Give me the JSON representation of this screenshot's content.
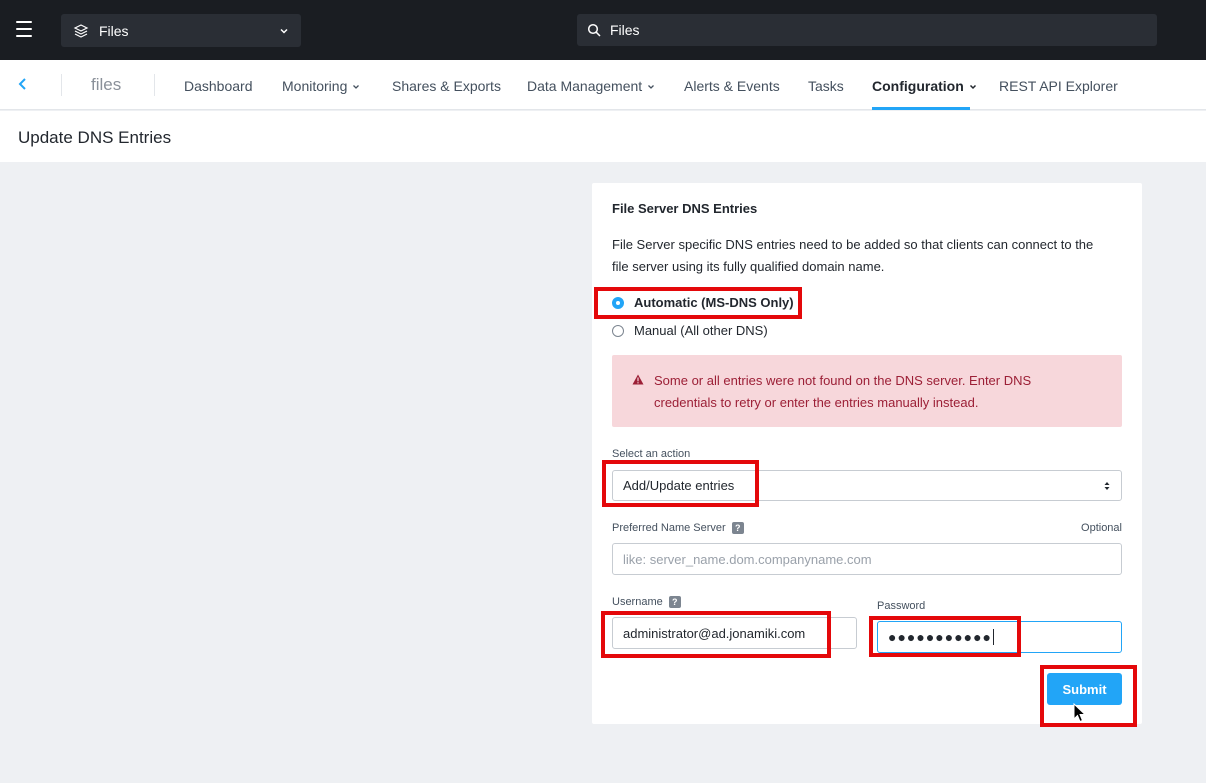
{
  "topbar": {
    "app_selector_label": "Files",
    "search_value": "Files"
  },
  "nav": {
    "brand": "files",
    "tabs": [
      {
        "label": "Dashboard",
        "dropdown": false
      },
      {
        "label": "Monitoring",
        "dropdown": true
      },
      {
        "label": "Shares & Exports",
        "dropdown": false
      },
      {
        "label": "Data Management",
        "dropdown": true
      },
      {
        "label": "Alerts & Events",
        "dropdown": false
      },
      {
        "label": "Tasks",
        "dropdown": false
      },
      {
        "label": "Configuration",
        "dropdown": true,
        "active": true
      },
      {
        "label": "REST API Explorer",
        "dropdown": false
      }
    ]
  },
  "page": {
    "title": "Update DNS Entries"
  },
  "form": {
    "section_title": "File Server DNS Entries",
    "description": "File Server specific DNS entries need to be added so that clients can connect to the file server using its fully qualified domain name.",
    "radios": [
      {
        "label": "Automatic (MS-DNS Only)",
        "checked": true
      },
      {
        "label": "Manual (All other DNS)",
        "checked": false
      }
    ],
    "alert_text": "Some or all entries were not found on the DNS server. Enter DNS credentials to retry or enter the entries manually instead.",
    "action_label": "Select an action",
    "action_value": "Add/Update entries",
    "name_server_label": "Preferred Name Server",
    "name_server_optional": "Optional",
    "name_server_placeholder": "like: server_name.dom.companyname.com",
    "username_label": "Username",
    "username_value": "administrator@ad.jonamiki.com",
    "password_label": "Password",
    "password_value": "●●●●●●●●●●●",
    "help_glyph": "?",
    "submit_label": "Submit"
  },
  "colors": {
    "accent": "#22a5f7",
    "topbar": "#1a1d22",
    "alert_bg": "#f7d7db",
    "alert_text": "#9c1f36",
    "highlight": "#e4080a"
  }
}
